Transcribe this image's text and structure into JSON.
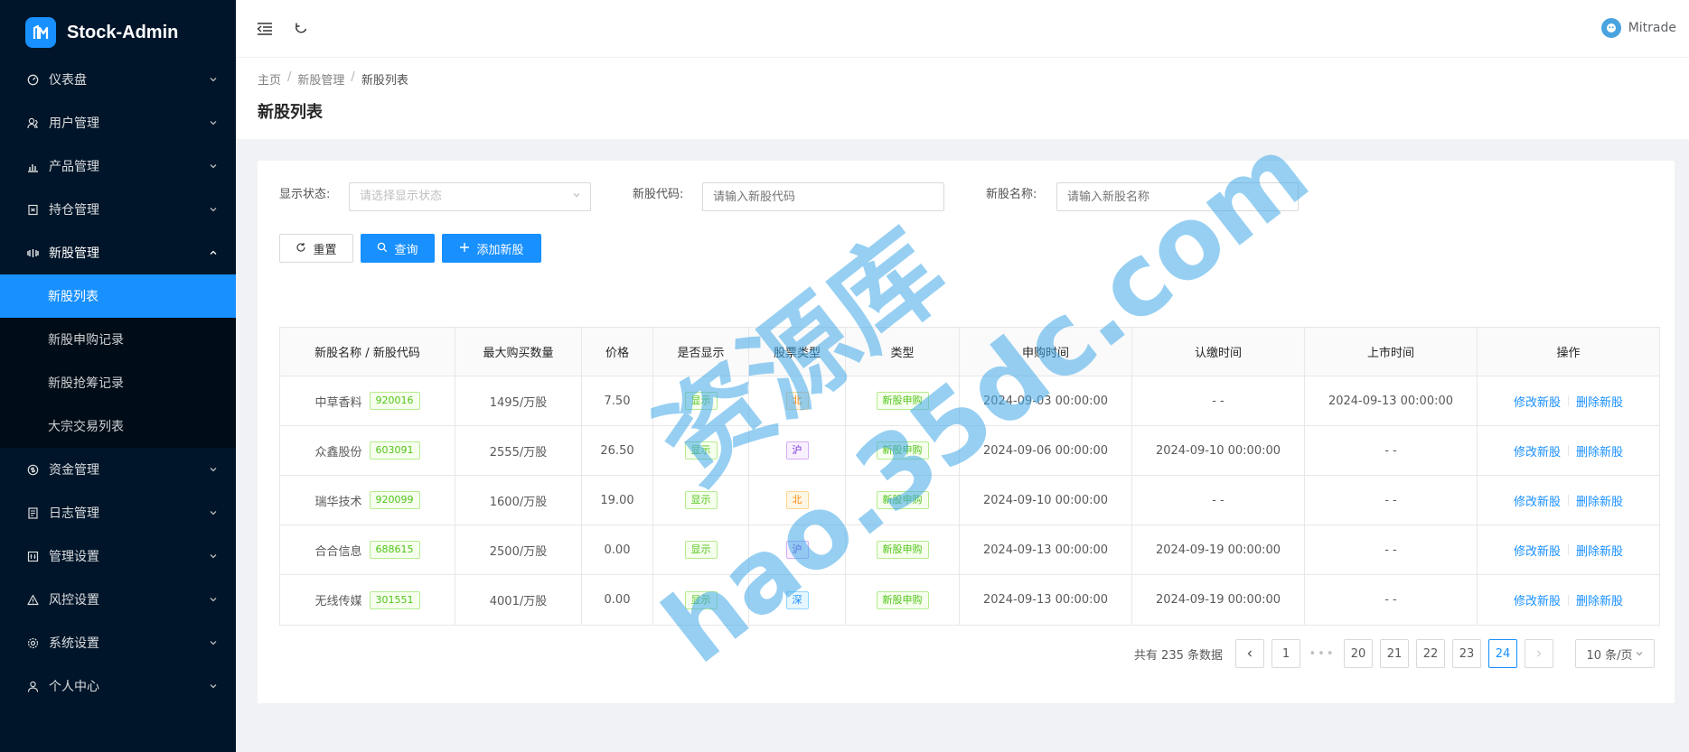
{
  "app": {
    "title": "Stock-Admin"
  },
  "sidebar": {
    "items": [
      {
        "label": "仪表盘",
        "icon": "dashboard-icon"
      },
      {
        "label": "用户管理",
        "icon": "users-icon"
      },
      {
        "label": "产品管理",
        "icon": "chart-icon"
      },
      {
        "label": "持仓管理",
        "icon": "position-icon"
      },
      {
        "label": "新股管理",
        "icon": "ipo-icon",
        "open": true
      },
      {
        "label": "资金管理",
        "icon": "money-icon"
      },
      {
        "label": "日志管理",
        "icon": "log-icon"
      },
      {
        "label": "管理设置",
        "icon": "admin-icon"
      },
      {
        "label": "风控设置",
        "icon": "warning-icon"
      },
      {
        "label": "系统设置",
        "icon": "gear-icon"
      },
      {
        "label": "个人中心",
        "icon": "user-icon"
      }
    ],
    "subitems": [
      {
        "label": "新股列表",
        "active": true
      },
      {
        "label": "新股申购记录"
      },
      {
        "label": "新股抢筹记录"
      },
      {
        "label": "大宗交易列表"
      }
    ]
  },
  "header": {
    "user_name": "Mitrade"
  },
  "breadcrumb": [
    "主页",
    "新股管理",
    "新股列表"
  ],
  "page_title": "新股列表",
  "filters": {
    "status_label": "显示状态:",
    "status_placeholder": "请选择显示状态",
    "code_label": "新股代码:",
    "code_placeholder": "请输入新股代码",
    "name_label": "新股名称:",
    "name_placeholder": "请输入新股名称"
  },
  "buttons": {
    "reset": "重置",
    "query": "查询",
    "add": "添加新股"
  },
  "table": {
    "columns": [
      "新股名称 / 新股代码",
      "最大购买数量",
      "价格",
      "是否显示",
      "股票类型",
      "类型",
      "申购时间",
      "认缴时间",
      "上市时间",
      "操作"
    ],
    "rows": [
      {
        "name": "中草香料",
        "code": "920016",
        "max": "1495/万股",
        "price": "7.50",
        "show": "显示",
        "stock_type": "北",
        "type": "新股申购",
        "apply": "2024-09-03 00:00:00",
        "pay": "- -",
        "list": "2024-09-13 00:00:00",
        "edit": "修改新股",
        "del": "删除新股"
      },
      {
        "name": "众鑫股份",
        "code": "603091",
        "max": "2555/万股",
        "price": "26.50",
        "show": "显示",
        "stock_type": "沪",
        "type": "新股申购",
        "apply": "2024-09-06 00:00:00",
        "pay": "2024-09-10 00:00:00",
        "list": "- -",
        "edit": "修改新股",
        "del": "删除新股"
      },
      {
        "name": "瑞华技术",
        "code": "920099",
        "max": "1600/万股",
        "price": "19.00",
        "show": "显示",
        "stock_type": "北",
        "type": "新股申购",
        "apply": "2024-09-10 00:00:00",
        "pay": "- -",
        "list": "- -",
        "edit": "修改新股",
        "del": "删除新股"
      },
      {
        "name": "合合信息",
        "code": "688615",
        "max": "2500/万股",
        "price": "0.00",
        "show": "显示",
        "stock_type": "沪",
        "type": "新股申购",
        "apply": "2024-09-13 00:00:00",
        "pay": "2024-09-19 00:00:00",
        "list": "- -",
        "edit": "修改新股",
        "del": "删除新股"
      },
      {
        "name": "无线传媒",
        "code": "301551",
        "max": "4001/万股",
        "price": "0.00",
        "show": "显示",
        "stock_type": "深",
        "type": "新股申购",
        "apply": "2024-09-13 00:00:00",
        "pay": "2024-09-19 00:00:00",
        "list": "- -",
        "edit": "修改新股",
        "del": "删除新股"
      }
    ]
  },
  "pagination": {
    "total": "共有 235 条数据",
    "pages": [
      "1",
      "20",
      "21",
      "22",
      "23",
      "24"
    ],
    "current": "24",
    "page_size": "10 条/页"
  },
  "watermark": {
    "line1": "资源库",
    "line2": "hao.35dc.com"
  }
}
